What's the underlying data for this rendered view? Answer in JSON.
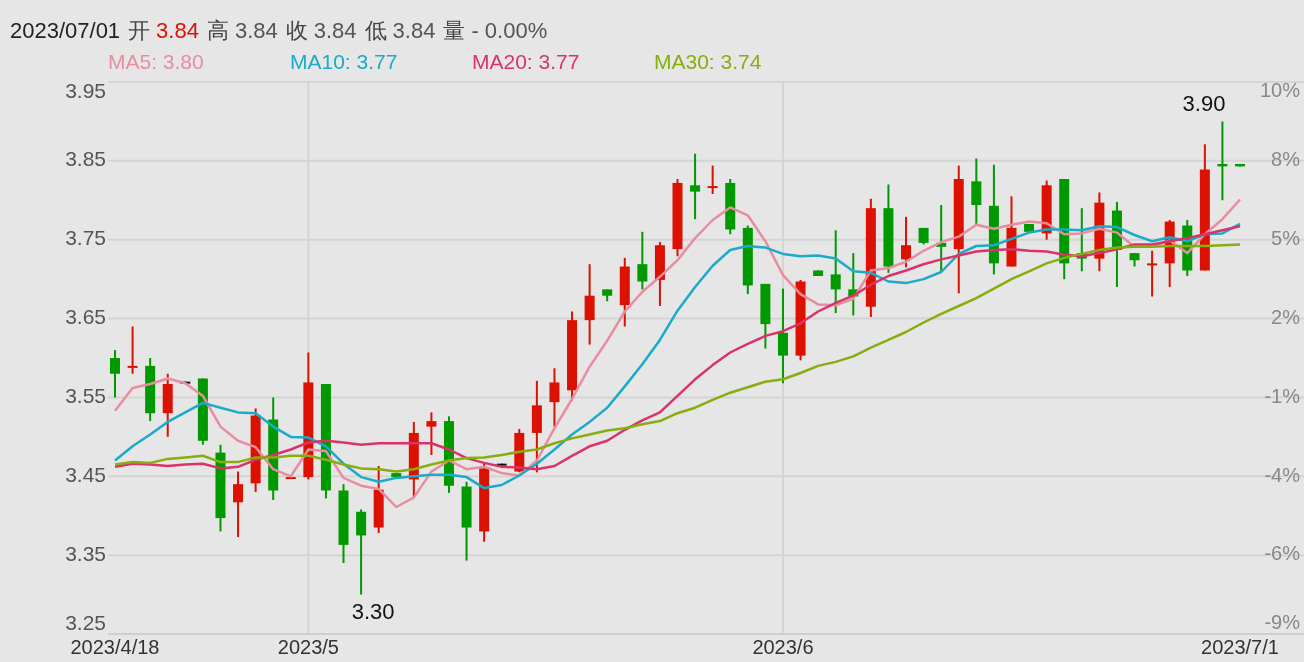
{
  "header": {
    "date": "2023/07/01",
    "fields": [
      {
        "label": "开",
        "value": "3.84",
        "color": "#dd1100"
      },
      {
        "label": "高",
        "value": "3.84",
        "color": "#555555"
      },
      {
        "label": "收",
        "value": "3.84",
        "color": "#555555"
      },
      {
        "label": "低",
        "value": "3.84",
        "color": "#555555"
      },
      {
        "label": "量",
        "value": "- 0.00%",
        "color": "#555555"
      }
    ]
  },
  "chart": {
    "percent_labels": [
      "10%",
      "8%",
      "5%",
      "2%",
      "-1%",
      "-4%",
      "-6%",
      "-9%"
    ],
    "chart_data": {
      "type": "candlestick",
      "grid": true,
      "ylim": [
        3.25,
        3.95
      ],
      "categories": [
        "2023/4/18",
        null,
        null,
        null,
        null,
        null,
        null,
        null,
        null,
        null,
        null,
        "2023/5",
        null,
        null,
        null,
        null,
        null,
        null,
        null,
        null,
        null,
        null,
        null,
        null,
        null,
        null,
        null,
        null,
        null,
        null,
        null,
        null,
        null,
        null,
        null,
        null,
        null,
        null,
        "2023/6",
        null,
        null,
        null,
        null,
        null,
        null,
        null,
        null,
        null,
        null,
        null,
        null,
        null,
        null,
        null,
        null,
        null,
        null,
        null,
        null,
        null,
        null,
        null,
        null,
        null,
        "2023/7/1"
      ],
      "yticks": [
        {
          "value": 3.95,
          "label": "3.95"
        },
        {
          "value": 3.85,
          "label": "3.85"
        },
        {
          "value": 3.75,
          "label": "3.75"
        },
        {
          "value": 3.65,
          "label": "3.65"
        },
        {
          "value": 3.55,
          "label": "3.55"
        },
        {
          "value": 3.45,
          "label": "3.45"
        },
        {
          "value": 3.35,
          "label": "3.35"
        },
        {
          "value": 3.25,
          "label": "3.25"
        }
      ],
      "ohlc": [
        [
          3.6,
          3.61,
          3.55,
          3.58
        ],
        [
          3.589,
          3.64,
          3.58,
          3.59
        ],
        [
          3.59,
          3.6,
          3.52,
          3.53
        ],
        [
          3.53,
          3.58,
          3.5,
          3.567
        ],
        [
          3.57,
          3.57,
          3.57,
          3.57
        ],
        [
          3.574,
          3.574,
          3.49,
          3.495
        ],
        [
          3.48,
          3.49,
          3.38,
          3.397
        ],
        [
          3.417,
          3.456,
          3.373,
          3.44
        ],
        [
          3.441,
          3.536,
          3.43,
          3.527
        ],
        [
          3.522,
          3.55,
          3.42,
          3.432
        ],
        [
          3.447,
          3.449,
          3.447,
          3.449
        ],
        [
          3.449,
          3.607,
          3.446,
          3.569
        ],
        [
          3.567,
          3.567,
          3.422,
          3.432
        ],
        [
          3.432,
          3.44,
          3.34,
          3.363
        ],
        [
          3.405,
          3.408,
          3.3,
          3.375
        ],
        [
          3.385,
          3.463,
          3.378,
          3.433
        ],
        [
          3.454,
          3.454,
          3.449,
          3.449
        ],
        [
          3.446,
          3.519,
          3.423,
          3.505
        ],
        [
          3.513,
          3.531,
          3.477,
          3.52
        ],
        [
          3.52,
          3.526,
          3.429,
          3.438
        ],
        [
          3.437,
          3.443,
          3.343,
          3.385
        ],
        [
          3.38,
          3.466,
          3.367,
          3.46
        ],
        [
          3.466,
          3.466,
          3.466,
          3.466
        ],
        [
          3.456,
          3.51,
          3.455,
          3.505
        ],
        [
          3.505,
          3.571,
          3.455,
          3.54
        ],
        [
          3.544,
          3.587,
          3.513,
          3.569
        ],
        [
          3.559,
          3.659,
          3.546,
          3.648
        ],
        [
          3.648,
          3.719,
          3.617,
          3.679
        ],
        [
          3.687,
          3.687,
          3.672,
          3.679
        ],
        [
          3.667,
          3.727,
          3.64,
          3.716
        ],
        [
          3.719,
          3.76,
          3.687,
          3.697
        ],
        [
          3.699,
          3.747,
          3.666,
          3.743
        ],
        [
          3.738,
          3.827,
          3.729,
          3.822
        ],
        [
          3.819,
          3.859,
          3.776,
          3.811
        ],
        [
          3.817,
          3.844,
          3.808,
          3.818
        ],
        [
          3.822,
          3.827,
          3.757,
          3.763
        ],
        [
          3.765,
          3.768,
          3.681,
          3.692
        ],
        [
          3.694,
          3.694,
          3.612,
          3.643
        ],
        [
          3.632,
          3.688,
          3.568,
          3.603
        ],
        [
          3.603,
          3.699,
          3.597,
          3.697
        ],
        [
          3.711,
          3.711,
          3.704,
          3.704
        ],
        [
          3.706,
          3.762,
          3.657,
          3.687
        ],
        [
          3.687,
          3.733,
          3.654,
          3.678
        ],
        [
          3.665,
          3.802,
          3.652,
          3.79
        ],
        [
          3.79,
          3.82,
          3.708,
          3.716
        ],
        [
          3.725,
          3.779,
          3.715,
          3.743
        ],
        [
          3.765,
          3.765,
          3.744,
          3.746
        ],
        [
          3.746,
          3.794,
          3.709,
          3.741
        ],
        [
          3.738,
          3.844,
          3.682,
          3.827
        ],
        [
          3.824,
          3.853,
          3.77,
          3.794
        ],
        [
          3.793,
          3.845,
          3.706,
          3.72
        ],
        [
          3.716,
          3.805,
          3.716,
          3.765
        ],
        [
          3.77,
          3.77,
          3.76,
          3.76
        ],
        [
          3.758,
          3.825,
          3.75,
          3.819
        ],
        [
          3.827,
          3.827,
          3.7,
          3.72
        ],
        [
          3.733,
          3.79,
          3.71,
          3.726
        ],
        [
          3.726,
          3.81,
          3.71,
          3.797
        ],
        [
          3.787,
          3.798,
          3.69,
          3.737
        ],
        [
          3.733,
          3.733,
          3.716,
          3.724
        ],
        [
          3.719,
          3.736,
          3.678,
          3.72
        ],
        [
          3.72,
          3.775,
          3.69,
          3.773
        ],
        [
          3.768,
          3.775,
          3.704,
          3.711
        ],
        [
          3.711,
          3.871,
          3.711,
          3.839
        ],
        [
          3.846,
          3.9,
          3.8,
          3.843
        ],
        [
          3.846,
          3.846,
          3.843,
          3.843
        ]
      ],
      "series": [
        {
          "name": "MA5: 3.80",
          "type": "line",
          "color": "#e88da0",
          "values": [
            3.533,
            3.562,
            3.567,
            3.574,
            3.568,
            3.552,
            3.513,
            3.495,
            3.487,
            3.459,
            3.45,
            3.484,
            3.482,
            3.448,
            3.438,
            3.434,
            3.411,
            3.423,
            3.456,
            3.47,
            3.459,
            3.462,
            3.454,
            3.451,
            3.47,
            3.511,
            3.548,
            3.589,
            3.622,
            3.659,
            3.684,
            3.703,
            3.724,
            3.752,
            3.775,
            3.791,
            3.781,
            3.748,
            3.705,
            3.681,
            3.668,
            3.667,
            3.675,
            3.711,
            3.714,
            3.722,
            3.736,
            3.747,
            3.754,
            3.769,
            3.764,
            3.769,
            3.773,
            3.771,
            3.757,
            3.758,
            3.764,
            3.759,
            3.741,
            3.741,
            3.749,
            3.733,
            3.757,
            3.776,
            3.801
          ]
        },
        {
          "name": "MA10: 3.77",
          "type": "line",
          "color": "#1aabca",
          "values": [
            3.47,
            3.488,
            3.503,
            3.519,
            3.531,
            3.543,
            3.537,
            3.531,
            3.53,
            3.513,
            3.5,
            3.499,
            3.488,
            3.466,
            3.449,
            3.443,
            3.448,
            3.45,
            3.452,
            3.452,
            3.449,
            3.435,
            3.439,
            3.451,
            3.466,
            3.484,
            3.503,
            3.519,
            3.537,
            3.564,
            3.592,
            3.623,
            3.66,
            3.69,
            3.717,
            3.737,
            3.742,
            3.74,
            3.732,
            3.729,
            3.73,
            3.726,
            3.71,
            3.708,
            3.697,
            3.695,
            3.7,
            3.709,
            3.732,
            3.742,
            3.743,
            3.751,
            3.759,
            3.763,
            3.763,
            3.762,
            3.767,
            3.766,
            3.756,
            3.748,
            3.753,
            3.748,
            3.757,
            3.758,
            3.77
          ]
        },
        {
          "name": "MA20: 3.77",
          "type": "line",
          "color": "#d9336a",
          "values": [
            3.462,
            3.466,
            3.465,
            3.463,
            3.465,
            3.466,
            3.46,
            3.462,
            3.471,
            3.477,
            3.484,
            3.493,
            3.495,
            3.493,
            3.49,
            3.492,
            3.492,
            3.492,
            3.492,
            3.484,
            3.473,
            3.467,
            3.462,
            3.461,
            3.459,
            3.463,
            3.476,
            3.488,
            3.495,
            3.509,
            3.521,
            3.531,
            3.552,
            3.573,
            3.591,
            3.607,
            3.618,
            3.628,
            3.634,
            3.644,
            3.659,
            3.67,
            3.679,
            3.693,
            3.704,
            3.711,
            3.719,
            3.725,
            3.73,
            3.735,
            3.737,
            3.738,
            3.736,
            3.735,
            3.731,
            3.729,
            3.733,
            3.738,
            3.744,
            3.744,
            3.748,
            3.752,
            3.757,
            3.762,
            3.767
          ]
        },
        {
          "name": "MA30: 3.74",
          "type": "line",
          "color": "#88ad0e",
          "values": [
            3.465,
            3.468,
            3.467,
            3.472,
            3.474,
            3.476,
            3.468,
            3.468,
            3.474,
            3.474,
            3.476,
            3.476,
            3.471,
            3.465,
            3.46,
            3.459,
            3.456,
            3.459,
            3.465,
            3.47,
            3.473,
            3.474,
            3.477,
            3.481,
            3.484,
            3.492,
            3.498,
            3.503,
            3.508,
            3.511,
            3.516,
            3.52,
            3.53,
            3.537,
            3.547,
            3.556,
            3.563,
            3.57,
            3.573,
            3.581,
            3.59,
            3.595,
            3.602,
            3.613,
            3.623,
            3.633,
            3.645,
            3.656,
            3.666,
            3.676,
            3.688,
            3.7,
            3.71,
            3.72,
            3.727,
            3.732,
            3.737,
            3.74,
            3.741,
            3.741,
            3.742,
            3.742,
            3.742,
            3.743,
            3.744
          ]
        }
      ],
      "annotations": [
        "3.90",
        "3.30"
      ]
    }
  }
}
